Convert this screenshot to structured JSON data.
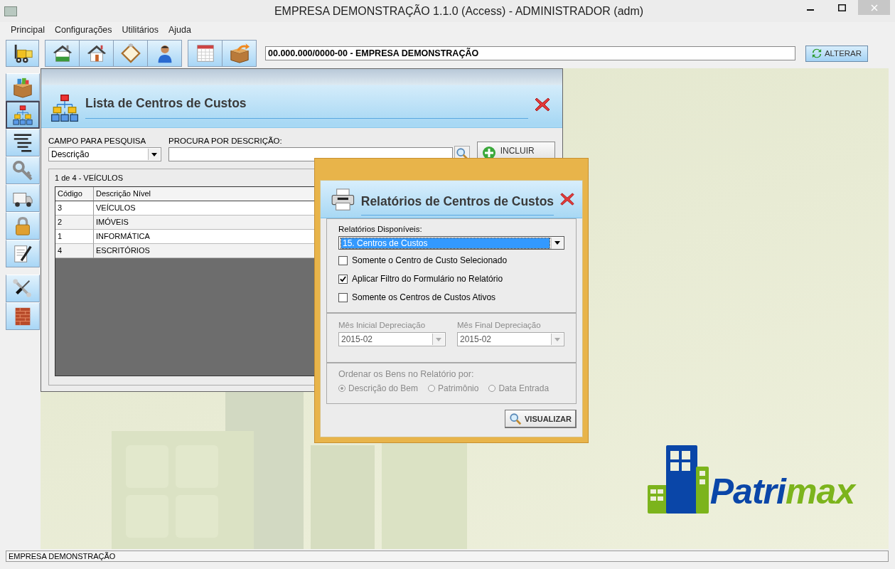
{
  "window": {
    "title": "EMPRESA DEMONSTRAÇÃO 1.1.0 (Access) - ADMINISTRADOR (adm)"
  },
  "menu": [
    {
      "label": "Principal"
    },
    {
      "label": "Configurações"
    },
    {
      "label": "Utilitários"
    },
    {
      "label": "Ajuda"
    }
  ],
  "toolbar": {
    "groups": [
      [
        {
          "kind": "forklift"
        }
      ],
      [
        {
          "kind": "warehouse"
        },
        {
          "kind": "house"
        },
        {
          "kind": "clipboard"
        },
        {
          "kind": "person"
        }
      ],
      [
        {
          "kind": "calendar"
        },
        {
          "kind": "parcel"
        }
      ]
    ],
    "company_field": {
      "value": "00.000.000/0000-00 - EMPRESA DEMONSTRAÇÃO"
    },
    "alter_button": {
      "label": "ALTERAR"
    }
  },
  "sidebar": {
    "groups": [
      [
        {
          "kind": "box",
          "selected": false
        },
        {
          "kind": "orgchart",
          "selected": true
        },
        {
          "kind": "outline",
          "selected": false
        },
        {
          "kind": "key",
          "selected": false
        },
        {
          "kind": "truck",
          "selected": false
        },
        {
          "kind": "padlock",
          "selected": false
        },
        {
          "kind": "document",
          "selected": false
        }
      ],
      [
        {
          "kind": "tools",
          "selected": false
        },
        {
          "kind": "bricks",
          "selected": false
        }
      ]
    ]
  },
  "list_window": {
    "title": "Lista de Centros de Custos",
    "field_label": "CAMPO PARA PESQUISA",
    "field_select": {
      "value": "Descrição"
    },
    "search_label": "PROCURA POR DESCRIÇÃO:",
    "add_button": {
      "label": "INCLUIR"
    },
    "record_status": "1 de 4 - VEÍCULOS",
    "table": {
      "columns": [
        "Código",
        "Descrição Nível"
      ],
      "rows": [
        {
          "cells": [
            "3",
            "VEÍCULOS"
          ]
        },
        {
          "cells": [
            "2",
            "IMÓVEIS"
          ]
        },
        {
          "cells": [
            "1",
            "INFORMÁTICA"
          ]
        },
        {
          "cells": [
            "4",
            "ESCRITÓRIOS"
          ]
        }
      ]
    }
  },
  "report_dialog": {
    "title": "Relatórios de Centros de Custos",
    "reports_label": "Relatórios Disponíveis:",
    "report_select": {
      "value": "15. Centros de Custos"
    },
    "options": [
      {
        "label": "Somente o Centro de Custo Selecionado",
        "checked": false
      },
      {
        "label": "Aplicar Filtro do Formulário no Relatório",
        "checked": true
      },
      {
        "label": "Somente os Centros de Custos Ativos",
        "checked": false
      }
    ],
    "depreciation": {
      "disabled": true,
      "fields": [
        {
          "label": "Mês Inicial Depreciação",
          "value": "2015-02"
        },
        {
          "label": "Mês Final Depreciação",
          "value": "2015-02"
        }
      ]
    },
    "order": {
      "label": "Ordenar os Bens no Relatório por:",
      "disabled": true,
      "options": [
        {
          "label": "Descrição do Bem",
          "selected": true
        },
        {
          "label": "Patrimônio",
          "selected": false
        },
        {
          "label": "Data Entrada",
          "selected": false
        }
      ]
    },
    "view_button": {
      "label": "VISUALIZAR"
    }
  },
  "logo": {
    "parts": [
      "Patri",
      "max"
    ]
  },
  "status_bar": {
    "text": "EMPRESA DEMONSTRAÇÃO"
  }
}
